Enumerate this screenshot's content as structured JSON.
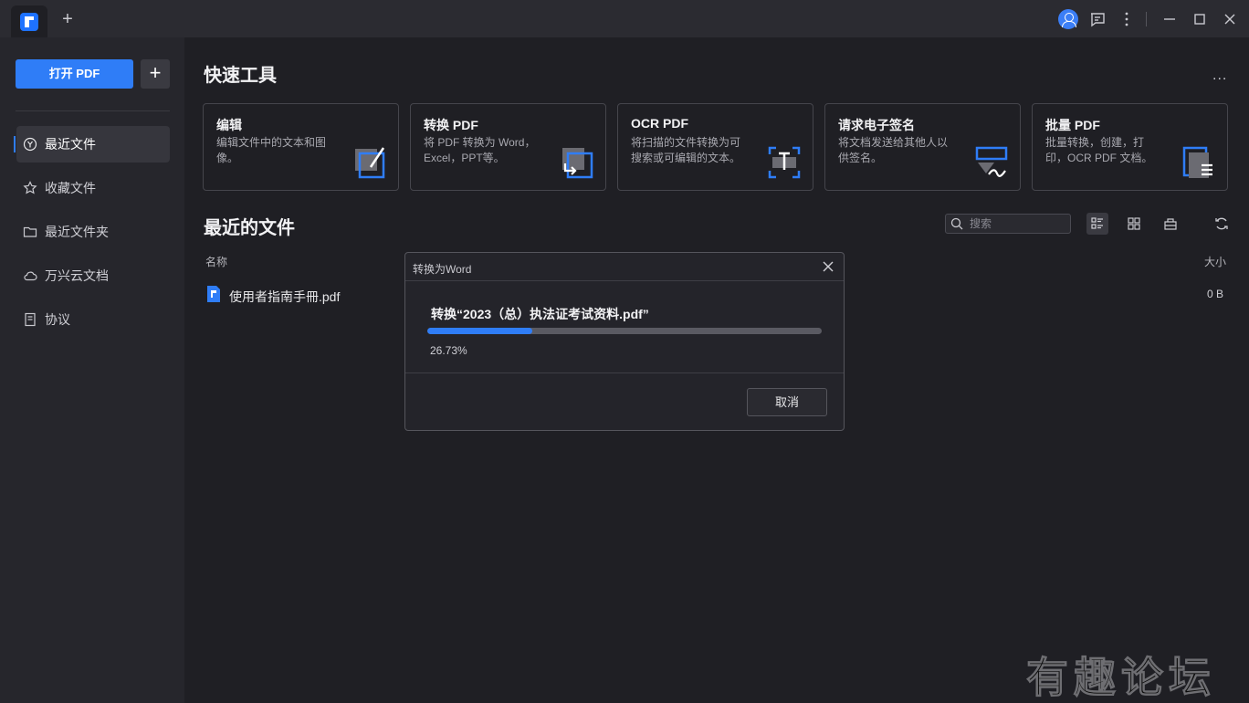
{
  "titlebar": {
    "new_tab": "+"
  },
  "sidebar": {
    "open_pdf_label": "打开 PDF",
    "add_label": "+",
    "items": [
      {
        "label": "最近文件",
        "icon": "recent-icon",
        "active": true
      },
      {
        "label": "收藏文件",
        "icon": "star-icon",
        "active": false
      },
      {
        "label": "最近文件夹",
        "icon": "folder-icon",
        "active": false
      },
      {
        "label": "万兴云文档",
        "icon": "cloud-icon",
        "active": false
      },
      {
        "label": "协议",
        "icon": "document-icon",
        "active": false
      }
    ]
  },
  "main": {
    "quick_tools_title": "快速工具",
    "more": "...",
    "tools": [
      {
        "title": "编辑",
        "desc": "编辑文件中的文本和图像。",
        "icon": "edit-tool-icon"
      },
      {
        "title": "转换 PDF",
        "desc": "将 PDF 转换为 Word，Excel，PPT等。",
        "icon": "convert-tool-icon"
      },
      {
        "title": "OCR PDF",
        "desc": "将扫描的文件转换为可搜索或可编辑的文本。",
        "icon": "ocr-tool-icon"
      },
      {
        "title": "请求电子签名",
        "desc": "将文档发送给其他人以供签名。",
        "icon": "signature-tool-icon"
      },
      {
        "title": "批量 PDF",
        "desc": "批量转换，创建，打印，OCR PDF 文档。",
        "icon": "batch-tool-icon"
      }
    ],
    "recent_title": "最近的文件",
    "search_placeholder": "搜索",
    "columns": {
      "name": "名称",
      "size": "大小"
    },
    "files": [
      {
        "name": "使用者指南手冊.pdf",
        "size": "0 B"
      }
    ]
  },
  "dialog": {
    "title": "转换为Word",
    "file_text": "转换“2023（总）执法证考试资料.pdf”",
    "progress": 26.73,
    "percent_text": "26.73%",
    "cancel_label": "取消"
  },
  "watermark": "有趣论坛",
  "colors": {
    "accent": "#2f7df7",
    "background": "#1f1f24",
    "sidebar": "#26262c"
  }
}
